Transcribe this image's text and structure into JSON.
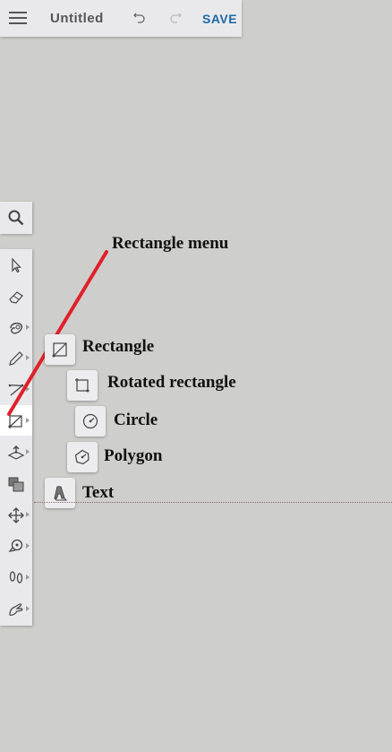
{
  "header": {
    "title": "Untitled",
    "save_label": "SAVE",
    "icons": [
      "menu-icon",
      "undo-icon",
      "redo-icon"
    ]
  },
  "search": {
    "icon": "search-icon"
  },
  "toolbar": {
    "tools": [
      {
        "name": "select",
        "icon": "arrow-icon"
      },
      {
        "name": "eraser",
        "icon": "eraser-icon"
      },
      {
        "name": "fill",
        "icon": "fill-icon"
      },
      {
        "name": "pencil",
        "icon": "pencil-icon"
      },
      {
        "name": "line",
        "icon": "line-icon"
      },
      {
        "name": "rectangle",
        "icon": "rectangle-icon",
        "active": true
      },
      {
        "name": "push-pull",
        "icon": "push-pull-icon"
      },
      {
        "name": "offset",
        "icon": "offset-icon"
      },
      {
        "name": "move",
        "icon": "move-icon"
      },
      {
        "name": "tape",
        "icon": "tape-icon"
      },
      {
        "name": "walk",
        "icon": "footprints-icon"
      },
      {
        "name": "interact",
        "icon": "hand-icon"
      }
    ]
  },
  "annotation": {
    "text": "Rectangle menu",
    "color": "#e0202a"
  },
  "rectangle_menu": {
    "items": [
      {
        "label": "Rectangle",
        "icon": "rectangle-icon"
      },
      {
        "label": "Rotated rectangle",
        "icon": "rotated-rectangle-icon"
      },
      {
        "label": "Circle",
        "icon": "circle-icon"
      },
      {
        "label": "Polygon",
        "icon": "polygon-icon"
      },
      {
        "label": "Text",
        "icon": "text-3d-icon"
      }
    ]
  },
  "colors": {
    "canvas": "#cececc",
    "accent": "#1d6aa5",
    "panel": "#e9e9ec"
  }
}
